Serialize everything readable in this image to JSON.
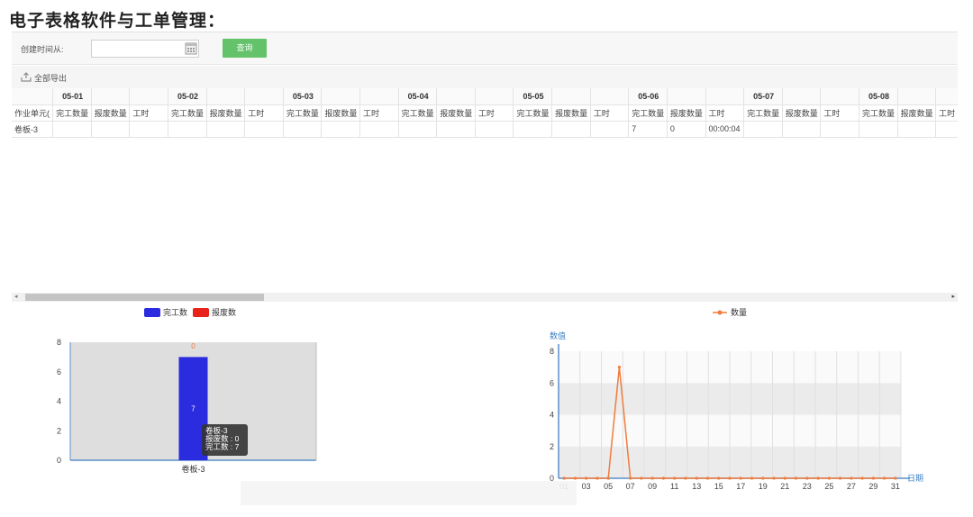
{
  "page_heading": "电子表格软件与工单管理：",
  "filter": {
    "created_from_label": "创建时间从:",
    "date_value": "",
    "query_label": "查询"
  },
  "toolbar": {
    "export_all_label": "全部导出"
  },
  "grid": {
    "dates": [
      "05-01",
      "05-02",
      "05-03",
      "05-04",
      "05-05",
      "05-06",
      "05-07",
      "05-08"
    ],
    "first_col_header": "作业单元(",
    "metric_headers": [
      "完工数量",
      "报废数量",
      "工时"
    ],
    "rows": [
      {
        "unit": "卷板-3",
        "cells": [
          [
            "",
            "",
            ""
          ],
          [
            "",
            "",
            ""
          ],
          [
            "",
            "",
            ""
          ],
          [
            "",
            "",
            ""
          ],
          [
            "",
            "",
            ""
          ],
          [
            "7",
            "0",
            "00:00:04"
          ],
          [
            "",
            "",
            ""
          ],
          [
            "",
            "",
            ""
          ]
        ]
      }
    ]
  },
  "chart_data": [
    {
      "type": "bar",
      "legend": [
        {
          "name": "完工数",
          "color": "#2b2bdf"
        },
        {
          "name": "报废数",
          "color": "#e8231a"
        }
      ],
      "categories": [
        "卷板-3"
      ],
      "series": [
        {
          "name": "完工数",
          "values": [
            7
          ],
          "color": "#2b2bdf"
        },
        {
          "name": "报废数",
          "values": [
            0
          ],
          "color": "#e8231a"
        }
      ],
      "ylim": [
        0,
        8
      ],
      "yticks": [
        0,
        2,
        4,
        6,
        8
      ],
      "grid": false,
      "legend_position": "top",
      "tooltip": {
        "lines": [
          "卷板-3",
          "报废数 : 0",
          "完工数 : 7"
        ]
      }
    },
    {
      "type": "line",
      "legend": [
        {
          "name": "数量",
          "color": "#f07c3c"
        }
      ],
      "ylabel": "数值",
      "xlabel": "日期",
      "ylim": [
        0,
        8
      ],
      "yticks": [
        0,
        2,
        4,
        6,
        8
      ],
      "x": [
        1,
        2,
        3,
        4,
        5,
        6,
        7,
        8,
        9,
        10,
        11,
        12,
        13,
        14,
        15,
        16,
        17,
        18,
        19,
        20,
        21,
        22,
        23,
        24,
        25,
        26,
        27,
        28,
        29,
        30,
        31
      ],
      "x_tick_labels": [
        "01",
        "03",
        "05",
        "07",
        "09",
        "11",
        "13",
        "15",
        "17",
        "19",
        "21",
        "23",
        "25",
        "27",
        "29",
        "31"
      ],
      "series": [
        {
          "name": "数量",
          "color": "#f07c3c",
          "values": [
            0,
            0,
            0,
            0,
            0,
            7,
            0,
            0,
            0,
            0,
            0,
            0,
            0,
            0,
            0,
            0,
            0,
            0,
            0,
            0,
            0,
            0,
            0,
            0,
            0,
            0,
            0,
            0,
            0,
            0,
            0
          ]
        }
      ],
      "grid": true,
      "legend_position": "top"
    }
  ]
}
